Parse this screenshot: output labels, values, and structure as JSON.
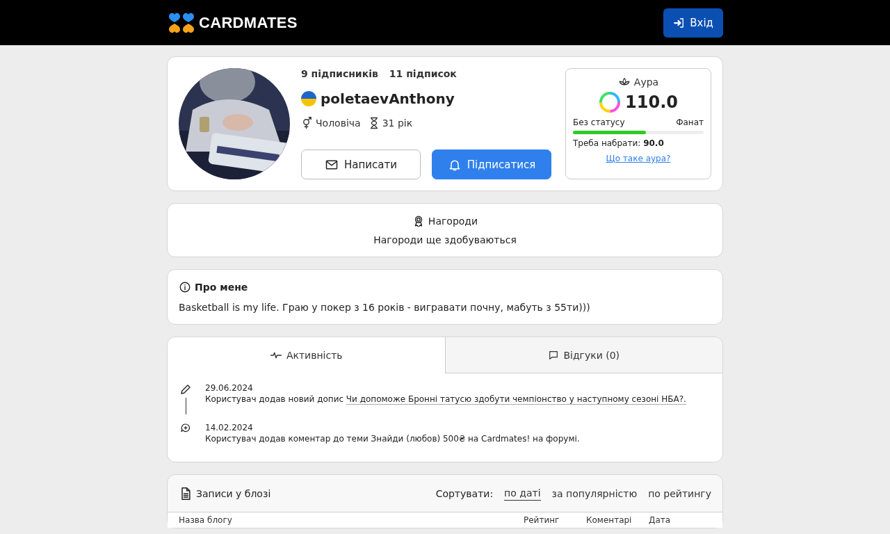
{
  "header": {
    "logo": "CARDMATES",
    "login_button": "Вхід"
  },
  "profile": {
    "followers": "9 підписників",
    "following": "11 підписок",
    "username": "poletaevAnthony",
    "gender": "Чоловіча",
    "age": "31 рік",
    "message_button": "Написати",
    "subscribe_button": "Підписатися",
    "aura": {
      "title": "Аура",
      "value": "110.0",
      "status_from": "Без статусу",
      "status_to": "Фанат",
      "level": 0.56,
      "need_label": "Треба набрати:",
      "need_value": "90.0",
      "link": "Що таке аура?"
    }
  },
  "awards": {
    "title": "Нагороди",
    "text": "Нагороди ще здобуваються"
  },
  "about": {
    "title": "Про мене",
    "text": "Basketball is my life. Граю у покер з 16 років - вигравати почну, мабуть з 55ти)))"
  },
  "tabs": [
    {
      "label": "Активність",
      "kind": "activity",
      "selected": true
    },
    {
      "label": "Відгуки (0)",
      "kind": "reviews",
      "selected": false
    }
  ],
  "activity": [
    {
      "kind": "post",
      "date": "29.06.2024",
      "text": "Користувач додав новий допис",
      "link": "Чи допоможе Бронні татусю здобути чемпіонство у наступному сезоні НБА?."
    },
    {
      "kind": "comment",
      "date": "14.02.2024",
      "text": "Користувач додав коментар до теми Знайди (любов) 500₴ на Cardmates! на форумі."
    }
  ],
  "blog": {
    "title": "Записи у блозі",
    "sort_label": "Сортувати:",
    "sort_options": [
      {
        "label": "по даті",
        "selected": true
      },
      {
        "label": "за популярністю",
        "selected": false
      },
      {
        "label": "по рейтингу",
        "selected": false
      }
    ],
    "columns": [
      "Назва блогу",
      "Рейтинг",
      "Коментарі",
      "Дата"
    ]
  }
}
